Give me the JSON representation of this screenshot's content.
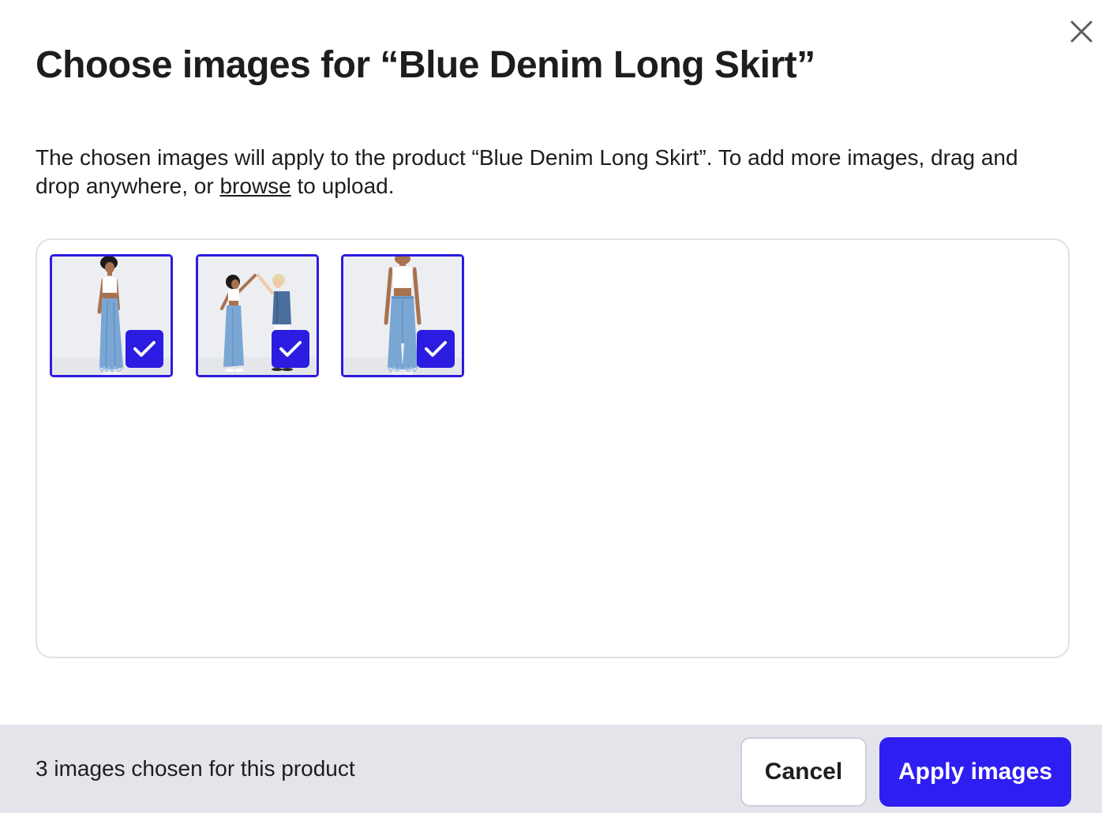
{
  "dialog": {
    "title": "Choose images for “Blue Denim Long Skirt”",
    "description_before": "The chosen images will apply to the product “Blue Denim Long Skirt”. To add more images, drag and drop anywhere, or ",
    "browse_link": "browse",
    "description_after": " to upload.",
    "close_icon": "close-icon"
  },
  "images": [
    {
      "subject": "woman in white crop top and long denim skirt, side view",
      "selected": true
    },
    {
      "subject": "two people high-fiving, one in denim skirt",
      "selected": true
    },
    {
      "subject": "front view of long denim skirt with slit",
      "selected": true
    }
  ],
  "footer": {
    "status": "3 images chosen for this product",
    "cancel_label": "Cancel",
    "apply_label": "Apply images"
  },
  "colors": {
    "accent": "#2f1ef2",
    "footer_bg": "#e4e5ea",
    "border": "#e1e1e6"
  }
}
